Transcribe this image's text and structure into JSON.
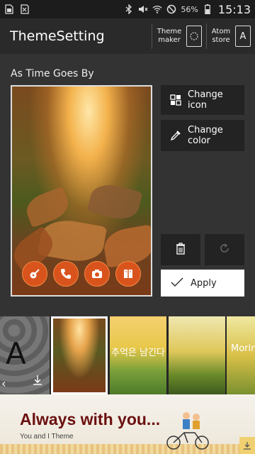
{
  "status_bar": {
    "battery": "56%",
    "time": "15:13",
    "icons": [
      "sim-icon",
      "sd-card-icon",
      "bluetooth-icon",
      "mute-icon",
      "wifi-icon",
      "no-signal-icon",
      "battery-icon"
    ]
  },
  "app_bar": {
    "title": "ThemeSetting",
    "theme_maker_label": "Theme maker",
    "atom_store_label": "Atom store",
    "atom_store_glyph": "A"
  },
  "main": {
    "theme_name": "As Time Goes By",
    "change_icon_label": "Change icon",
    "change_color_label": "Change color",
    "apply_label": "Apply",
    "dock_icons": [
      "guitar-icon",
      "phone-icon",
      "camera-icon",
      "book-icon"
    ]
  },
  "strip": {
    "thumb1_letter": "A",
    "thumb3_text": "추억은 남긴다",
    "thumb5_text": "Morin"
  },
  "ad": {
    "title": "Always with you...",
    "subtitle": "You and I Theme"
  }
}
